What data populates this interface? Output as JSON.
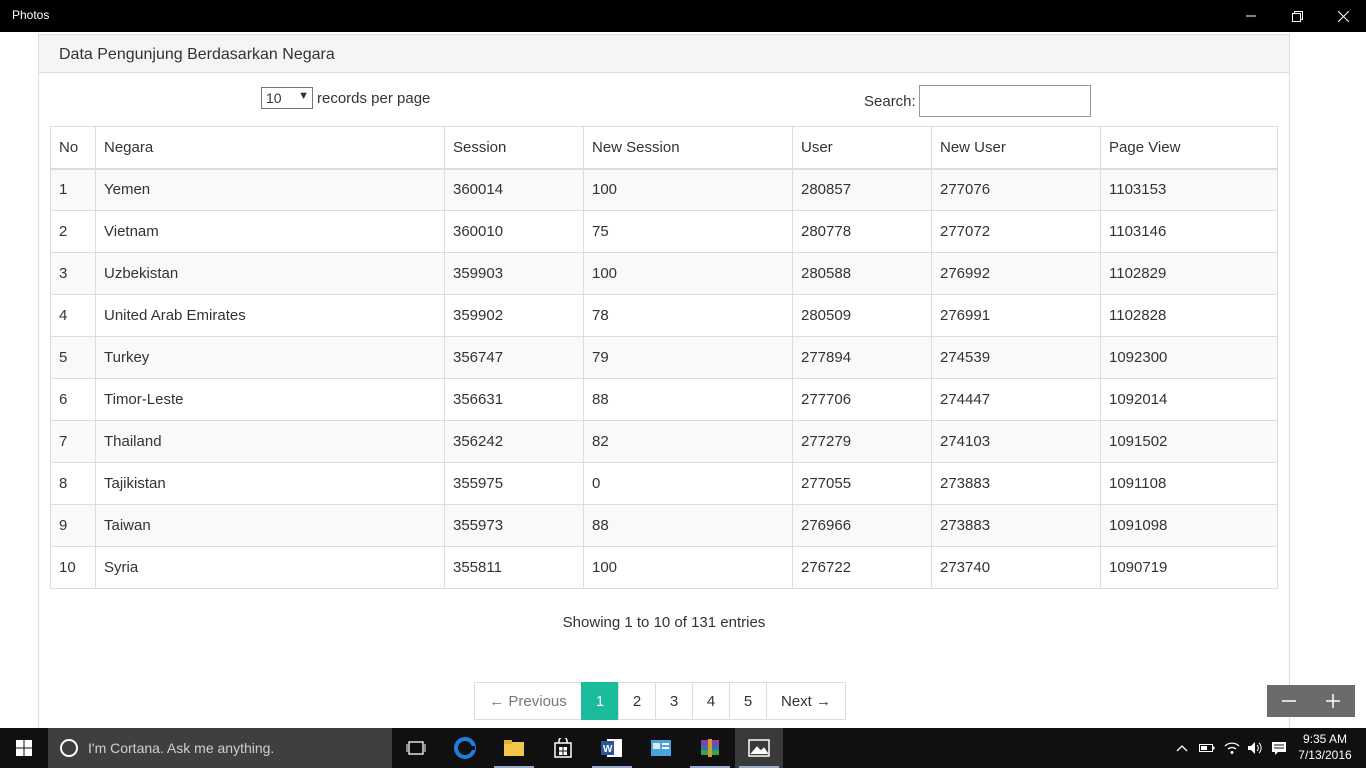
{
  "window": {
    "title": "Photos"
  },
  "panel": {
    "heading": "Data Pengunjung Berdasarkan Negara"
  },
  "length": {
    "value": "10",
    "label": "records per page"
  },
  "search": {
    "label": "Search:",
    "value": ""
  },
  "table": {
    "headers": [
      "No",
      "Negara",
      "Session",
      "New Session",
      "User",
      "New User",
      "Page View"
    ],
    "rows": [
      [
        "1",
        "Yemen",
        "360014",
        "100",
        "280857",
        "277076",
        "1103153"
      ],
      [
        "2",
        "Vietnam",
        "360010",
        "75",
        "280778",
        "277072",
        "1103146"
      ],
      [
        "3",
        "Uzbekistan",
        "359903",
        "100",
        "280588",
        "276992",
        "1102829"
      ],
      [
        "4",
        "United Arab Emirates",
        "359902",
        "78",
        "280509",
        "276991",
        "1102828"
      ],
      [
        "5",
        "Turkey",
        "356747",
        "79",
        "277894",
        "274539",
        "1092300"
      ],
      [
        "6",
        "Timor-Leste",
        "356631",
        "88",
        "277706",
        "274447",
        "1092014"
      ],
      [
        "7",
        "Thailand",
        "356242",
        "82",
        "277279",
        "274103",
        "1091502"
      ],
      [
        "8",
        "Tajikistan",
        "355975",
        "0",
        "277055",
        "273883",
        "1091108"
      ],
      [
        "9",
        "Taiwan",
        "355973",
        "88",
        "276966",
        "273883",
        "1091098"
      ],
      [
        "10",
        "Syria",
        "355811",
        "100",
        "276722",
        "273740",
        "1090719"
      ]
    ]
  },
  "info": "Showing 1 to 10 of 131 entries",
  "pagination": {
    "previous": "← Previous",
    "pages": [
      "1",
      "2",
      "3",
      "4",
      "5"
    ],
    "active": "1",
    "next": "Next →"
  },
  "taskbar": {
    "search_placeholder": "I'm Cortana. Ask me anything.",
    "time": "9:35 AM",
    "date": "7/13/2016"
  },
  "colors": {
    "accent": "#1abc9c",
    "taskbar": "#101010",
    "titlebar": "#000000"
  }
}
